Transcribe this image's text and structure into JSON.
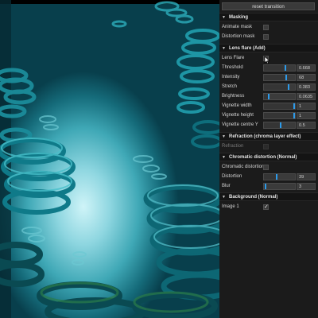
{
  "viewport": {
    "description_colors": {
      "deep": "#0a4050",
      "mid": "#3fa8b6",
      "light": "#cff4f8",
      "spiral": "#1f9fae"
    }
  },
  "panel": {
    "reset_label": "reset transition",
    "sections": {
      "masking": {
        "title": "Masking",
        "animate_mask": "Animate mask",
        "distortion_mask": "Distortion mask"
      },
      "lens_flare": {
        "title": "Lens flare (Add)",
        "lens_flare_label": "Lens Flare",
        "params": [
          {
            "label": "Threshold",
            "value": "0.668",
            "fraction": 0.668
          },
          {
            "label": "Intensity",
            "value": "68",
            "fraction": 0.68
          },
          {
            "label": "Stretch",
            "value": "0.383",
            "fraction": 0.78
          },
          {
            "label": "Brightness",
            "value": "0.0635",
            "fraction": 0.12
          },
          {
            "label": "Vignette width",
            "value": "1",
            "fraction": 1.0
          },
          {
            "label": "Vignette height",
            "value": "1",
            "fraction": 1.0
          },
          {
            "label": "Vignette centre Y",
            "value": "0.5",
            "fraction": 0.5
          }
        ]
      },
      "refraction": {
        "title": "Refraction (chroma layer effect)",
        "refraction_label": "Refraction"
      },
      "chromatic": {
        "title": "Chromatic distortion (Normal)",
        "chromatic_label": "Chromatic distortion",
        "params": [
          {
            "label": "Distortion",
            "value": "39",
            "fraction": 0.39
          },
          {
            "label": "Blur",
            "value": "3",
            "fraction": 0.03
          }
        ]
      },
      "background": {
        "title": "Background (Normal)",
        "image_label": "Image 1",
        "image_checked": "✓"
      }
    },
    "colors": {
      "accent": "#2d9bea",
      "panel_bg": "#1b1b1b",
      "header_bg": "#141414"
    }
  }
}
